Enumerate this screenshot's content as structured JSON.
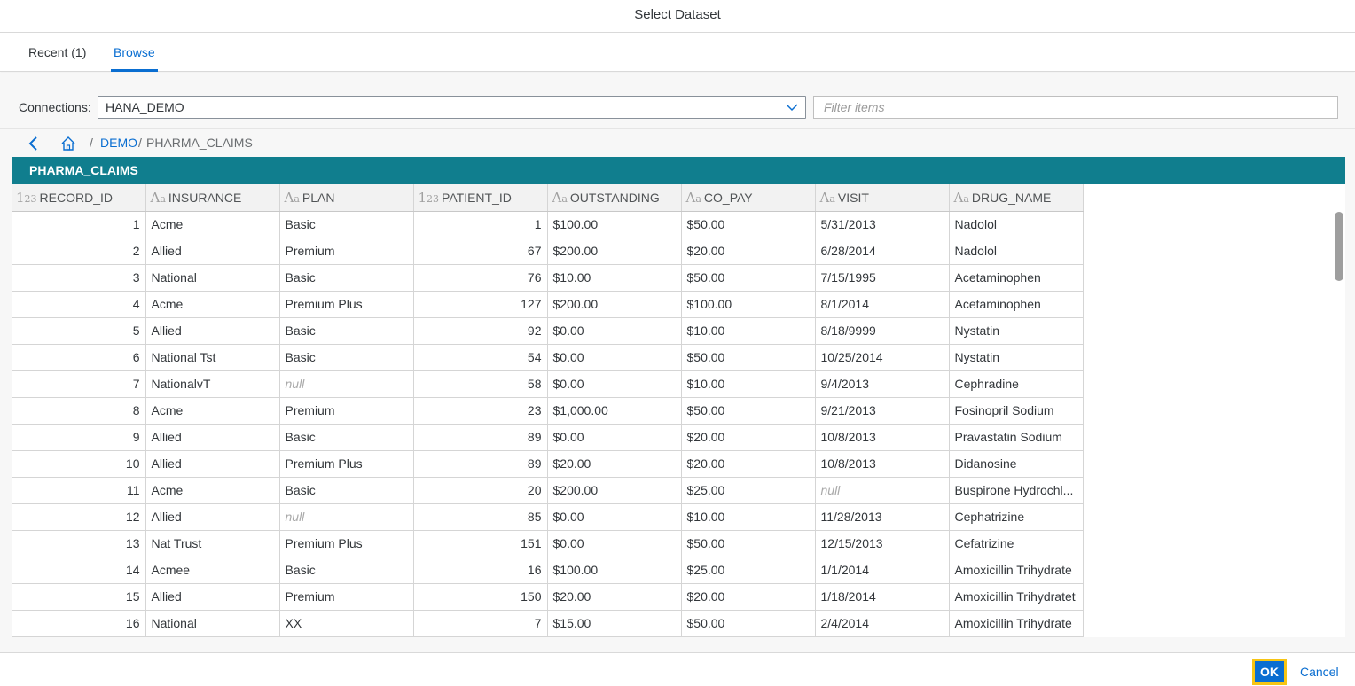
{
  "dialog": {
    "title": "Select Dataset"
  },
  "tabs": [
    {
      "label": "Recent (1)",
      "selected": false
    },
    {
      "label": "Browse",
      "selected": true
    }
  ],
  "connections": {
    "label": "Connections:",
    "value": "HANA_DEMO",
    "filter_placeholder": "Filter items"
  },
  "breadcrumbs": {
    "separator": "/",
    "items": [
      "DEMO",
      "PHARMA_CLAIMS"
    ]
  },
  "table": {
    "title": "PHARMA_CLAIMS",
    "columns": [
      {
        "name": "RECORD_ID",
        "type": "numeric"
      },
      {
        "name": "INSURANCE",
        "type": "text"
      },
      {
        "name": "PLAN",
        "type": "text"
      },
      {
        "name": "PATIENT_ID",
        "type": "numeric"
      },
      {
        "name": "OUTSTANDING",
        "type": "text"
      },
      {
        "name": "CO_PAY",
        "type": "text"
      },
      {
        "name": "VISIT",
        "type": "text"
      },
      {
        "name": "DRUG_NAME",
        "type": "text"
      }
    ],
    "rows": [
      [
        "1",
        "Acme",
        "Basic",
        "1",
        "$100.00",
        "$50.00",
        "5/31/2013",
        "Nadolol"
      ],
      [
        "2",
        "Allied",
        "Premium",
        "67",
        "$200.00",
        "$20.00",
        "6/28/2014",
        "Nadolol"
      ],
      [
        "3",
        "National",
        "Basic",
        "76",
        "$10.00",
        "$50.00",
        "7/15/1995",
        "Acetaminophen"
      ],
      [
        "4",
        "Acme",
        "Premium Plus",
        "127",
        "$200.00",
        "$100.00",
        "8/1/2014",
        "Acetaminophen"
      ],
      [
        "5",
        "Allied",
        "Basic",
        "92",
        "$0.00",
        "$10.00",
        "8/18/9999",
        "Nystatin"
      ],
      [
        "6",
        "National Tst",
        "Basic",
        "54",
        "$0.00",
        "$50.00",
        "10/25/2014",
        "Nystatin"
      ],
      [
        "7",
        "NationalvT",
        "null",
        "58",
        "$0.00",
        "$10.00",
        "9/4/2013",
        "Cephradine"
      ],
      [
        "8",
        "Acme",
        "Premium",
        "23",
        "$1,000.00",
        "$50.00",
        "9/21/2013",
        "Fosinopril Sodium"
      ],
      [
        "9",
        "Allied",
        "Basic",
        "89",
        "$0.00",
        "$20.00",
        "10/8/2013",
        "Pravastatin Sodium"
      ],
      [
        "10",
        "Allied",
        "Premium Plus",
        "89",
        "$20.00",
        "$20.00",
        "10/8/2013",
        "Didanosine"
      ],
      [
        "11",
        "Acme",
        "Basic",
        "20",
        "$200.00",
        "$25.00",
        "null",
        "Buspirone Hydrochl..."
      ],
      [
        "12",
        "Allied",
        "null",
        "85",
        "$0.00",
        "$10.00",
        "11/28/2013",
        "Cephatrizine"
      ],
      [
        "13",
        "Nat Trust",
        "Premium Plus",
        "151",
        "$0.00",
        "$50.00",
        "12/15/2013",
        "Cefatrizine"
      ],
      [
        "14",
        "Acmee",
        "Basic",
        "16",
        "$100.00",
        "$25.00",
        "1/1/2014",
        "Amoxicillin Trihydrate"
      ],
      [
        "15",
        "Allied",
        "Premium",
        "150",
        "$20.00",
        "$20.00",
        "1/18/2014",
        "Amoxicillin Trihydratet"
      ],
      [
        "16",
        "National",
        "XX",
        "7",
        "$15.00",
        "$50.00",
        "2/4/2014",
        "Amoxicillin Trihydrate"
      ]
    ]
  },
  "footer": {
    "ok_label": "OK",
    "cancel_label": "Cancel"
  },
  "colors": {
    "accent": "#0a6ed1",
    "table_header_bg": "#107e8e",
    "focus_outline": "#f7c514"
  }
}
